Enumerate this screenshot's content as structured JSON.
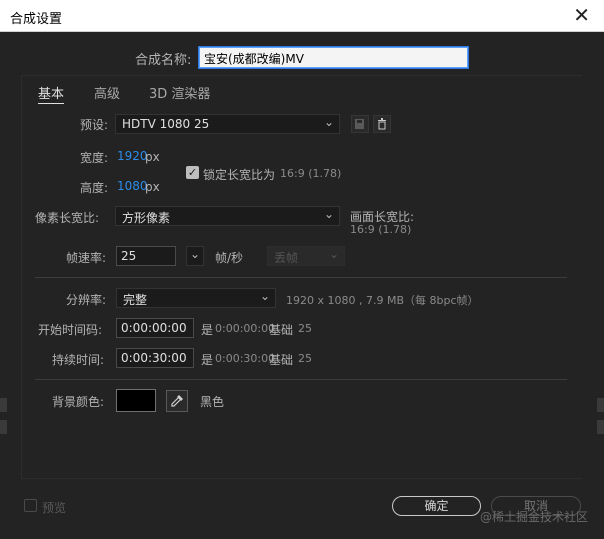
{
  "window": {
    "title": "合成设置"
  },
  "comp_name": {
    "label": "合成名称:",
    "value": "宝安(成都改编)MV"
  },
  "tabs": [
    {
      "label": "基本"
    },
    {
      "label": "高级"
    },
    {
      "label": "3D 渲染器"
    }
  ],
  "preset": {
    "label": "预设:",
    "value": "HDTV 1080 25"
  },
  "width": {
    "label": "宽度:",
    "value": "1920",
    "unit": "px"
  },
  "height": {
    "label": "高度:",
    "value": "1080",
    "unit": "px"
  },
  "lock_aspect": {
    "label": "锁定长宽比为",
    "ratio": "16:9 (1.78)",
    "checked": true
  },
  "pixel_aspect": {
    "label": "像素长宽比:",
    "value": "方形像素"
  },
  "frame_aspect": {
    "label": "画面长宽比:",
    "value": "16:9 (1.78)"
  },
  "frame_rate": {
    "label": "帧速率:",
    "value": "25",
    "unit": "帧/秒",
    "drop_frame": "丢帧"
  },
  "resolution": {
    "label": "分辨率:",
    "value": "完整",
    "info": "1920 x 1080 , 7.9 MB（每 8bpc帧）"
  },
  "start_timecode": {
    "label": "开始时间码:",
    "value": "0:00:00:00",
    "is_label": "是",
    "is_value": "0:00:00:00",
    "base_label": "基础",
    "base_value": "25"
  },
  "duration": {
    "label": "持续时间:",
    "value": "0:00:30:00",
    "is_label": "是",
    "is_value": "0:00:30:00",
    "base_label": "基础",
    "base_value": "25"
  },
  "background_color": {
    "label": "背景颜色:",
    "name": "黑色",
    "color": "#000000"
  },
  "preview": {
    "label": "预览"
  },
  "buttons": {
    "ok": "确定",
    "cancel": "取消"
  },
  "watermark": "@稀土掘金技术社区"
}
